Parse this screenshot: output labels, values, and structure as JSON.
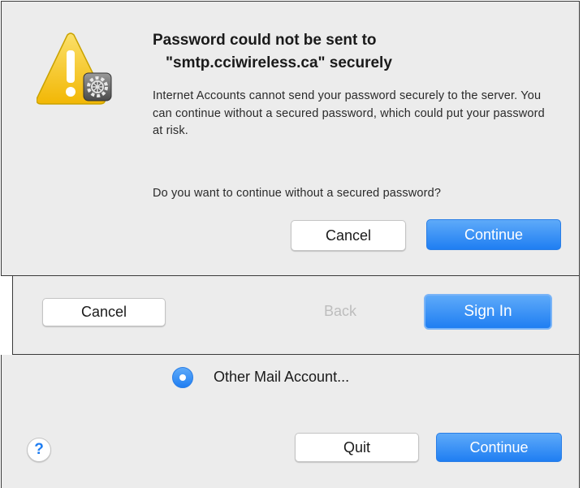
{
  "alert": {
    "title_line1": "Password could not be sent to",
    "title_line2": "\"smtp.cciwireless.ca\"   securely",
    "body": "Internet Accounts cannot send your password securely to the server. You can continue without a secured password, which could put your password at risk.",
    "question": "Do you want to continue without a secured password?",
    "cancel_label": "Cancel",
    "continue_label": "Continue",
    "icon": "warning-with-gear-icon"
  },
  "strip": {
    "cancel_label": "Cancel",
    "back_label": "Back",
    "signin_label": "Sign In"
  },
  "bottom": {
    "radio_label": "Other Mail Account...",
    "help_label": "?",
    "quit_label": "Quit",
    "continue_label": "Continue"
  },
  "colors": {
    "accent_blue": "#1f7ef2",
    "panel_bg": "#ececec",
    "warning_yellow": "#f5c518"
  }
}
